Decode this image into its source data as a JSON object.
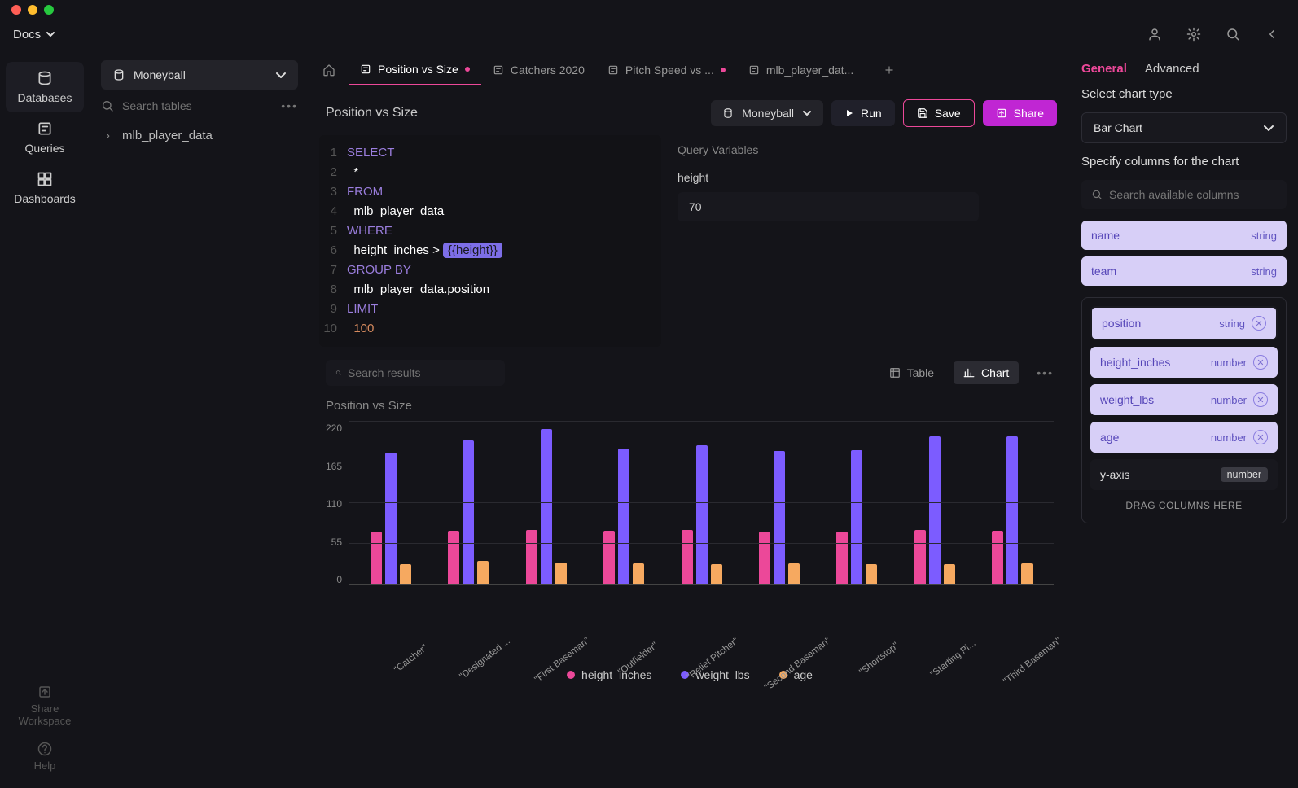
{
  "topnav": {
    "docs_label": "Docs"
  },
  "rail": {
    "databases": "Databases",
    "queries": "Queries",
    "dashboards": "Dashboards",
    "share_workspace": "Share\nWorkspace",
    "help": "Help"
  },
  "tables_panel": {
    "db_name": "Moneyball",
    "search_placeholder": "Search tables",
    "tree": [
      "mlb_player_data"
    ]
  },
  "tabs": [
    {
      "label": "Position vs Size",
      "active": true,
      "dirty": true
    },
    {
      "label": "Catchers 2020",
      "active": false,
      "dirty": false
    },
    {
      "label": "Pitch Speed vs ...",
      "active": false,
      "dirty": true
    },
    {
      "label": "mlb_player_dat...",
      "active": false,
      "dirty": false
    }
  ],
  "toolbar": {
    "query_title": "Position vs Size",
    "db_selector": "Moneyball",
    "run": "Run",
    "save": "Save",
    "share": "Share"
  },
  "editor_lines": [
    {
      "n": 1,
      "segments": [
        [
          "kw",
          "SELECT"
        ]
      ]
    },
    {
      "n": 2,
      "segments": [
        [
          "",
          "  *"
        ]
      ]
    },
    {
      "n": 3,
      "segments": [
        [
          "kw",
          "FROM"
        ]
      ]
    },
    {
      "n": 4,
      "segments": [
        [
          "",
          "  mlb_player_data"
        ]
      ]
    },
    {
      "n": 5,
      "segments": [
        [
          "kw",
          "WHERE"
        ]
      ]
    },
    {
      "n": 6,
      "segments": [
        [
          "",
          "  height_inches > "
        ],
        [
          "tpl",
          "{{height}}"
        ]
      ]
    },
    {
      "n": 7,
      "segments": [
        [
          "kw",
          "GROUP BY"
        ]
      ]
    },
    {
      "n": 8,
      "segments": [
        [
          "",
          "  mlb_player_data.position"
        ]
      ]
    },
    {
      "n": 9,
      "segments": [
        [
          "kw",
          "LIMIT"
        ]
      ]
    },
    {
      "n": 10,
      "segments": [
        [
          "",
          "  "
        ],
        [
          "lit",
          "100"
        ]
      ]
    }
  ],
  "query_vars": {
    "title": "Query Variables",
    "var_name": "height",
    "var_value": "70"
  },
  "results": {
    "search_placeholder": "Search results",
    "table_label": "Table",
    "chart_label": "Chart"
  },
  "chart_data": {
    "type": "bar",
    "title": "Position vs Size",
    "ylabel": "",
    "xlabel": "",
    "ylim": [
      0,
      220
    ],
    "y_ticks": [
      0,
      55,
      110,
      165,
      220
    ],
    "categories": [
      "\"Catcher\"",
      "\"Designated ...",
      "\"First Baseman\"",
      "\"Outfielder\"",
      "\"Relief Pitcher\"",
      "\"Second Baseman\"",
      "\"Shortstop\"",
      "\"Starting Pi...",
      "\"Third Baseman\""
    ],
    "series": [
      {
        "name": "height_inches",
        "color": "#ec4899",
        "values": [
          72,
          73,
          74,
          73,
          74,
          71,
          71,
          74,
          73
        ]
      },
      {
        "name": "weight_lbs",
        "color": "#7c5cff",
        "values": [
          178,
          195,
          210,
          184,
          188,
          180,
          182,
          200,
          200
        ]
      },
      {
        "name": "age",
        "color": "#f6a960",
        "values": [
          28,
          32,
          30,
          29,
          28,
          29,
          28,
          28,
          29
        ]
      }
    ]
  },
  "config": {
    "tabs": {
      "general": "General",
      "advanced": "Advanced"
    },
    "select_chart_type": "Select chart type",
    "chart_type_value": "Bar Chart",
    "specify_columns": "Specify columns for the chart",
    "columns_search_placeholder": "Search available columns",
    "available_columns": [
      {
        "name": "name",
        "type": "string"
      },
      {
        "name": "team",
        "type": "string"
      }
    ],
    "selected_columns": [
      {
        "name": "position",
        "type": "string",
        "boxed": true
      },
      {
        "name": "height_inches",
        "type": "number",
        "boxed": false
      },
      {
        "name": "weight_lbs",
        "type": "number",
        "boxed": false
      },
      {
        "name": "age",
        "type": "number",
        "boxed": false
      }
    ],
    "y_axis_label": "y-axis",
    "y_axis_type": "number",
    "drag_hint": "DRAG COLUMNS HERE"
  }
}
